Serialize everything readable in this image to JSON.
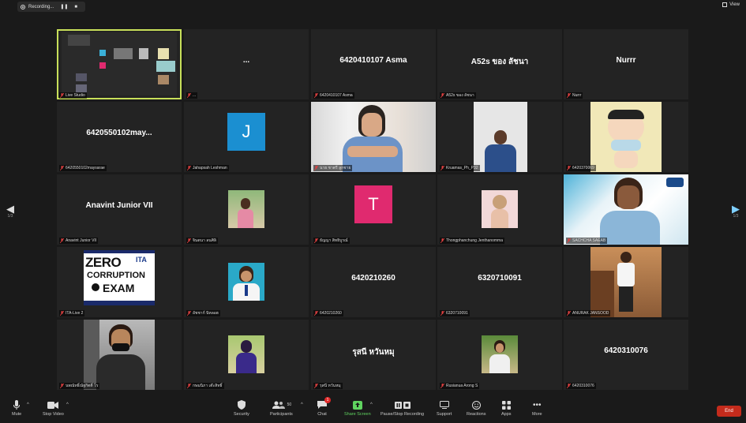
{
  "topbar": {
    "recording_label": "Recording...",
    "view_label": "View"
  },
  "nav": {
    "left_page": "1/3",
    "right_page": "1/3"
  },
  "tiles": [
    {
      "name": "Live Studio",
      "display": "",
      "kind": "screen"
    },
    {
      "name": "...",
      "display": "...",
      "kind": "text"
    },
    {
      "name": "6420410107 Asma",
      "display": "6420410107 Asma",
      "kind": "text"
    },
    {
      "name": "A52s ของ ลัชนา",
      "display": "A52s ของ ลัชนา",
      "kind": "text"
    },
    {
      "name": "Nurrr",
      "display": "Nurrr",
      "kind": "text"
    },
    {
      "name": "6420550102maysarae",
      "display": "6420550102may...",
      "kind": "text"
    },
    {
      "name": "Jahapsah Leshman",
      "display": "J",
      "kind": "letter",
      "color": "#1b8fd1"
    },
    {
      "name": "นาย ชาตรี ลูกชาย",
      "display": "",
      "kind": "video"
    },
    {
      "name": "Kruamas_Ph_P32",
      "display": "",
      "kind": "video"
    },
    {
      "name": "6420370069",
      "display": "",
      "kind": "image"
    },
    {
      "name": "Anavint Junior VII",
      "display": "Anavint Junior VII",
      "kind": "text"
    },
    {
      "name": "จินตนา ลนศิลิ",
      "display": "",
      "kind": "image"
    },
    {
      "name": "ธัญญา สิทธิบูรณ์",
      "display": "T",
      "kind": "letter",
      "color": "#e02a6f"
    },
    {
      "name": "Thongphanchung Jenthanomma",
      "display": "",
      "kind": "image"
    },
    {
      "name": "SACHCHA SAEAB",
      "display": "",
      "kind": "video"
    },
    {
      "name": "ITA-Live 2",
      "display": "",
      "kind": "image"
    },
    {
      "name": "อัชชาก์ นิหลอฮ",
      "display": "",
      "kind": "image"
    },
    {
      "name": "6420210260",
      "display": "6420210260",
      "kind": "text"
    },
    {
      "name": "6320710091",
      "display": "6320710091",
      "kind": "text"
    },
    {
      "name": "ANURAK JANSOOD",
      "display": "",
      "kind": "image"
    },
    {
      "name": "นพณัทธิ์ณัฐกิตติ์ โร",
      "display": "",
      "kind": "image"
    },
    {
      "name": "กษมนิภา เต๊ะสิทธิ์",
      "display": "",
      "kind": "image"
    },
    {
      "name": "รุสนี หวันหมุ",
      "display": "รุสนี หวันหมุ",
      "kind": "text"
    },
    {
      "name": "Rusianua Arong S",
      "display": "",
      "kind": "image"
    },
    {
      "name": "6420310076",
      "display": "6420310076",
      "kind": "text"
    }
  ],
  "zero_poster": {
    "line1": "ZERO",
    "line2": "CORRUPTION",
    "line3": "EXAM",
    "tag": "ITA"
  },
  "toolbar": {
    "mute": "Mute",
    "stop_video": "Stop Video",
    "security": "Security",
    "participants": "Participants",
    "participants_count": "50",
    "chat": "Chat",
    "chat_badge": "1",
    "share_screen": "Share Screen",
    "pause_recording": "Pause/Stop Recording",
    "support": "Support",
    "reactions": "Reactions",
    "apps": "Apps",
    "more": "More",
    "end": "End"
  },
  "colors": {
    "active_border": "#c8e05a",
    "share_green": "#5fd35f",
    "end_red": "#c42b1c"
  }
}
